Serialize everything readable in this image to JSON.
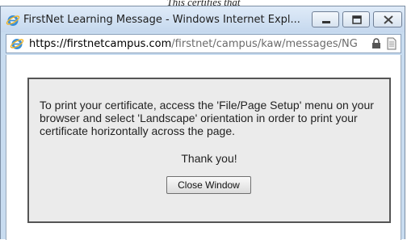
{
  "background": {
    "partial_text": "This certifies that"
  },
  "window": {
    "title": "FirstNet Learning Message - Windows Internet Expl...",
    "buttons": {
      "minimize": "minimize-icon",
      "maximize": "maximize-icon",
      "close": "close-icon"
    }
  },
  "address": {
    "host": "https://firstnetcampus.com",
    "path": "/firstnet/campus/kaw/messages/NG",
    "icons": [
      "ie-icon",
      "lock-icon",
      "page-icon"
    ]
  },
  "dialog": {
    "message": "To print your certificate, access the 'File/Page Setup' menu on your browser and select 'Landscape' orientation in order to print your certificate horizontally across the page.",
    "thanks": "Thank you!",
    "close_button": "Close Window"
  },
  "colors": {
    "title_bar": "#c8dcf0",
    "dialog_bg": "#ebebeb",
    "dialog_border": "#555555"
  }
}
